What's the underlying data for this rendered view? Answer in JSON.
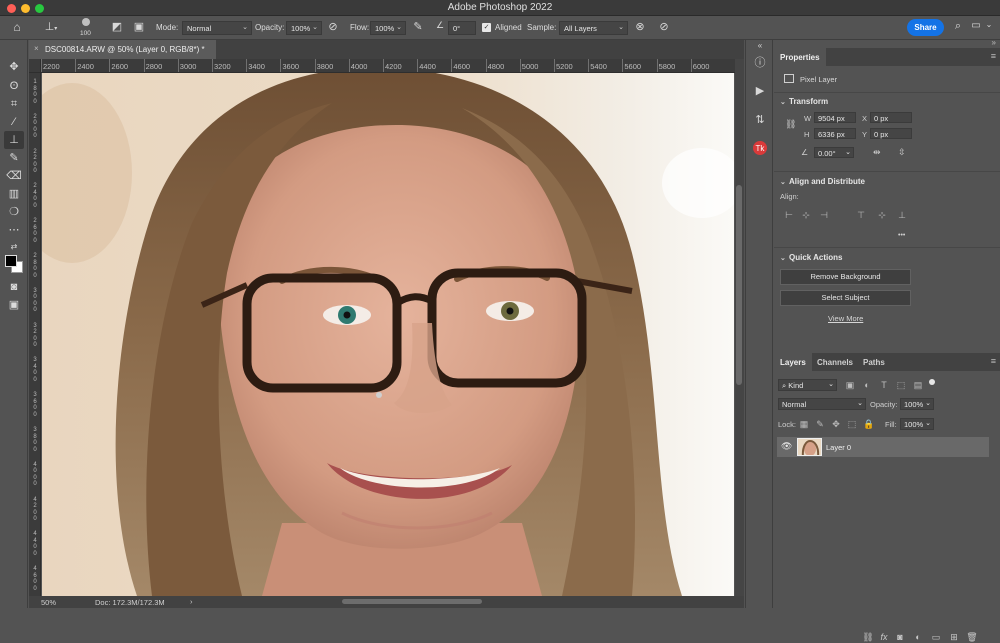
{
  "window": {
    "title": "Adobe Photoshop 2022",
    "traffic_colors": [
      "#ff5f57",
      "#febc2e",
      "#28c840"
    ]
  },
  "options_bar": {
    "brush_size": "100",
    "mode_label": "Mode:",
    "mode_value": "Normal",
    "opacity_label": "Opacity:",
    "opacity_value": "100%",
    "flow_label": "Flow:",
    "flow_value": "100%",
    "angle_value": "0°",
    "aligned_label": "Aligned",
    "aligned_checked": true,
    "sample_label": "Sample:",
    "sample_value": "All Layers",
    "share_label": "Share",
    "accent": "#1473e6"
  },
  "document": {
    "tab_title": "DSC00814.ARW @ 50% (Layer 0, RGB/8*) *",
    "close_glyph": "×"
  },
  "rulers": {
    "horizontal": [
      "2200",
      "2400",
      "2600",
      "2800",
      "3000",
      "3200",
      "3400",
      "3600",
      "3800",
      "4000",
      "4200",
      "4400",
      "4600",
      "4800",
      "5000",
      "5200",
      "5400",
      "5600",
      "5800",
      "6000"
    ],
    "vertical": [
      "1800",
      "2000",
      "2200",
      "2400",
      "2600",
      "2800",
      "3000",
      "3200",
      "3400",
      "3600",
      "3800",
      "4000",
      "4200",
      "4400",
      "4600"
    ]
  },
  "status": {
    "zoom": "50%",
    "doc": "Doc: 172.3M/172.3M",
    "arrow": "›"
  },
  "tools": [
    "move-tool-icon",
    "lasso-tool-icon",
    "crop-tool-icon",
    "eyedropper-tool-icon",
    "clone-stamp-tool-icon",
    "brush-tool-icon",
    "eraser-tool-icon",
    "gradient-tool-icon",
    "blur-tool-icon",
    "more-tools-icon"
  ],
  "properties": {
    "tab_label": "Properties",
    "layer_type": "Pixel Layer",
    "transform_title": "Transform",
    "w_label": "W",
    "w_value": "9504 px",
    "h_label": "H",
    "h_value": "6336 px",
    "x_label": "X",
    "x_value": "0 px",
    "y_label": "Y",
    "y_value": "0 px",
    "angle_value": "0.00°",
    "align_title": "Align and Distribute",
    "align_label": "Align:",
    "more": "•••",
    "quick_actions_title": "Quick Actions",
    "remove_bg": "Remove Background",
    "select_subject": "Select Subject",
    "view_more": "View More"
  },
  "layers": {
    "tabs": [
      "Layers",
      "Channels",
      "Paths"
    ],
    "kind_label": "Kind",
    "blend_mode": "Normal",
    "opacity_label": "Opacity:",
    "opacity_value": "100%",
    "lock_label": "Lock:",
    "fill_label": "Fill:",
    "fill_value": "100%",
    "layer_name": "Layer 0"
  }
}
